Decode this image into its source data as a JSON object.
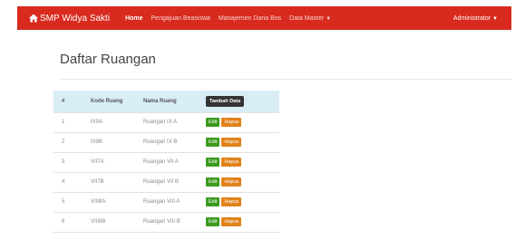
{
  "navbar": {
    "brand": "SMP Widya Sakti",
    "items": [
      {
        "label": "Home"
      },
      {
        "label": "Pengajuan Beasiswa"
      },
      {
        "label": "Manajemen Dana Bos"
      },
      {
        "label": "Data Master"
      }
    ],
    "user": "Administrator",
    "color": "#d82a1e"
  },
  "page": {
    "title": "Daftar Ruangan"
  },
  "table": {
    "headers": {
      "no": "#",
      "kode": "Kode Ruang",
      "nama": "Nama Ruang"
    },
    "add_button": "Tambah Data",
    "edit_label": "Edit",
    "delete_label": "Hapus",
    "rows": [
      {
        "no": "1",
        "kode": "IX9A",
        "nama": "Ruangan IX A"
      },
      {
        "no": "2",
        "kode": "IX9B",
        "nama": "Ruangan IX B"
      },
      {
        "no": "3",
        "kode": "VII7A",
        "nama": "Ruangan VII A"
      },
      {
        "no": "4",
        "kode": "VII7B",
        "nama": "Ruangan VII B"
      },
      {
        "no": "5",
        "kode": "VIII8A",
        "nama": "Ruangan VIII A"
      },
      {
        "no": "6",
        "kode": "VIII8B",
        "nama": "Ruangan VIII B"
      }
    ]
  }
}
